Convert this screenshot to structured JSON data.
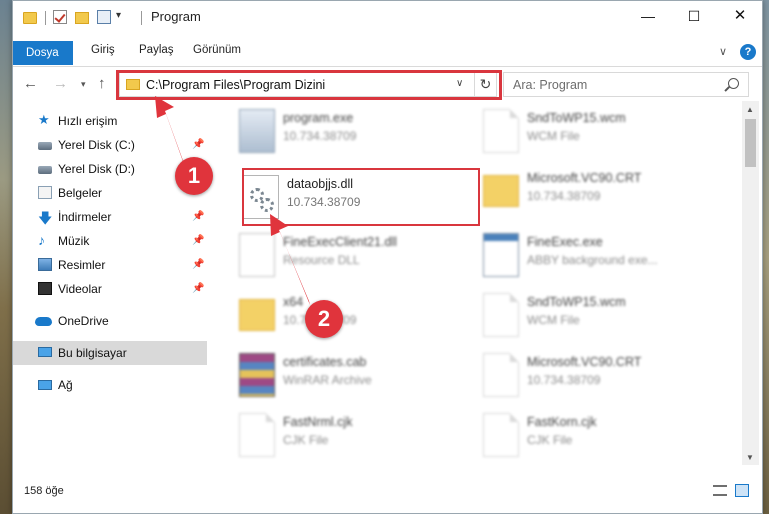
{
  "window": {
    "title": "Program",
    "minimize": "—",
    "maximize": "☐",
    "close": "✕"
  },
  "ribbon": {
    "tabs": [
      "Dosya",
      "Giriş",
      "Paylaş",
      "Görünüm"
    ],
    "expand": "∨",
    "help": "?"
  },
  "address": {
    "path": "C:\\Program Files\\Program Dizini",
    "dropdown": "∨",
    "refresh": "↻"
  },
  "search": {
    "placeholder": "Ara: Program"
  },
  "sidebar": {
    "items": [
      {
        "label": "Hızlı erişim",
        "icon": "star-icon"
      },
      {
        "label": "Yerel Disk (C:)",
        "icon": "drive-icon",
        "pinned": true
      },
      {
        "label": "Yerel Disk (D:)",
        "icon": "drive-icon"
      },
      {
        "label": "Belgeler",
        "icon": "documents-icon"
      },
      {
        "label": "İndirmeler",
        "icon": "download-icon",
        "pinned": true
      },
      {
        "label": "Müzik",
        "icon": "music-icon",
        "pinned": true
      },
      {
        "label": "Resimler",
        "icon": "pictures-icon",
        "pinned": true
      },
      {
        "label": "Videolar",
        "icon": "video-icon",
        "pinned": true
      },
      {
        "label": "OneDrive",
        "icon": "cloud-icon"
      },
      {
        "label": "Bu bilgisayar",
        "icon": "computer-icon",
        "selected": true
      },
      {
        "label": "Ağ",
        "icon": "network-icon"
      }
    ]
  },
  "files": [
    {
      "name": "program.exe",
      "desc": "10.734.38709",
      "icon": "exe-icon"
    },
    {
      "name": "SndToWP15.wcm",
      "desc": "WCM File",
      "icon": "document-icon"
    },
    {
      "name": "dataobjjs.dll",
      "desc": "10.734.38709",
      "icon": "dll-icon",
      "highlighted": true
    },
    {
      "name": "Microsoft.VC90.CRT",
      "desc": "10.734.38709",
      "icon": "folder-icon"
    },
    {
      "name": "FineExecClient21.dll",
      "desc": "Resource DLL",
      "icon": "dll-icon"
    },
    {
      "name": "FineExec.exe",
      "desc": "ABBY background exe...",
      "icon": "app-icon"
    },
    {
      "name": "x64",
      "desc": "10.734.38709",
      "icon": "folder-icon"
    },
    {
      "name": "SndToWP15.wcm",
      "desc": "WCM File",
      "icon": "document-icon"
    },
    {
      "name": "certificates.cab",
      "desc": "WinRAR Archive",
      "icon": "archive-icon"
    },
    {
      "name": "Microsoft.VC90.CRT",
      "desc": "10.734.38709",
      "icon": "folder-icon"
    },
    {
      "name": "FastNrml.cjk",
      "desc": "CJK File",
      "icon": "document-icon"
    },
    {
      "name": "FastKorn.cjk",
      "desc": "CJK File",
      "icon": "document-icon"
    }
  ],
  "status": {
    "count": "158 öğe"
  },
  "annotations": {
    "step1": "1",
    "step2": "2",
    "color": "#e0343c"
  }
}
